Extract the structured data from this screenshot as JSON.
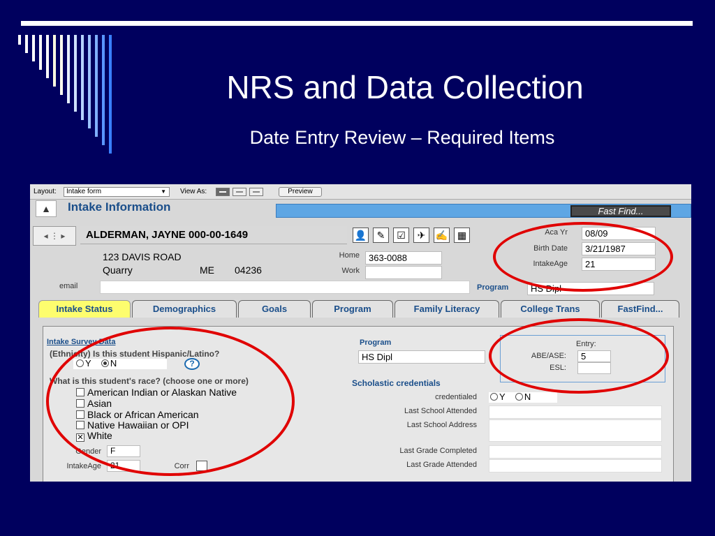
{
  "slide": {
    "title": "NRS and Data Collection",
    "subtitle": "Date Entry Review – Required Items",
    "accent_color": "#e00000",
    "background_color": "#00005e"
  },
  "layout_bar": {
    "layout_label": "Layout:",
    "layout_value": "Intake form",
    "view_as_label": "View As:",
    "preview_label": "Preview"
  },
  "header": {
    "title": "Intake Information",
    "fast_find": "Fast Find..."
  },
  "student": {
    "name": "ALDERMAN, JAYNE 000-00-1649",
    "address": "123 DAVIS ROAD",
    "city": "Quarry",
    "state": "ME",
    "zip": "04236",
    "home_label": "Home",
    "home_phone": "363-0088",
    "work_label": "Work",
    "work_phone": "",
    "email_label": "email",
    "email": "",
    "program_label": "Program",
    "program": "HS Dipl"
  },
  "info": {
    "aca_yr_label": "Aca Yr",
    "aca_yr": "08/09",
    "birth_date_label": "Birth Date",
    "birth_date": "3/21/1987",
    "intake_age_label": "IntakeAge",
    "intake_age": "21"
  },
  "tabs": [
    {
      "label": "Intake Status"
    },
    {
      "label": "Demographics"
    },
    {
      "label": "Goals"
    },
    {
      "label": "Program"
    },
    {
      "label": "Family Literacy"
    },
    {
      "label": "College Trans"
    },
    {
      "label": "FastFind..."
    }
  ],
  "survey": {
    "heading": "Intake Survey Data",
    "ethnicity_q": "(Ethnicity) Is this student Hispanic/Latino?",
    "yes": "Y",
    "no": "N",
    "help": "?",
    "race_q": "What is this student's race? (choose one or more)",
    "races": [
      {
        "label": "American Indian or Alaskan Native",
        "checked": false
      },
      {
        "label": "Asian",
        "checked": false
      },
      {
        "label": "Black or African American",
        "checked": false
      },
      {
        "label": "Native Hawaiian or OPI",
        "checked": false
      },
      {
        "label": "White",
        "checked": true
      }
    ],
    "gender_label": "Gender",
    "gender": "F",
    "intake_age_label": "IntakeAge",
    "intake_age": "21",
    "corr_label": "Corr"
  },
  "program_panel": {
    "label": "Program",
    "value": "HS Dipl",
    "entry_label": "Entry:",
    "abe_label": "ABE/ASE:",
    "abe_value": "5",
    "esl_label": "ESL:",
    "esl_value": "",
    "scholastic_label": "Scholastic credentials",
    "credentialed_label": "credentialed",
    "cred_yes": "Y",
    "cred_no": "N",
    "last_school_label": "Last School Attended",
    "last_school_address_label": "Last School Address",
    "last_grade_completed_label": "Last Grade Completed",
    "last_grade_attended_label": "Last Grade Attended"
  }
}
